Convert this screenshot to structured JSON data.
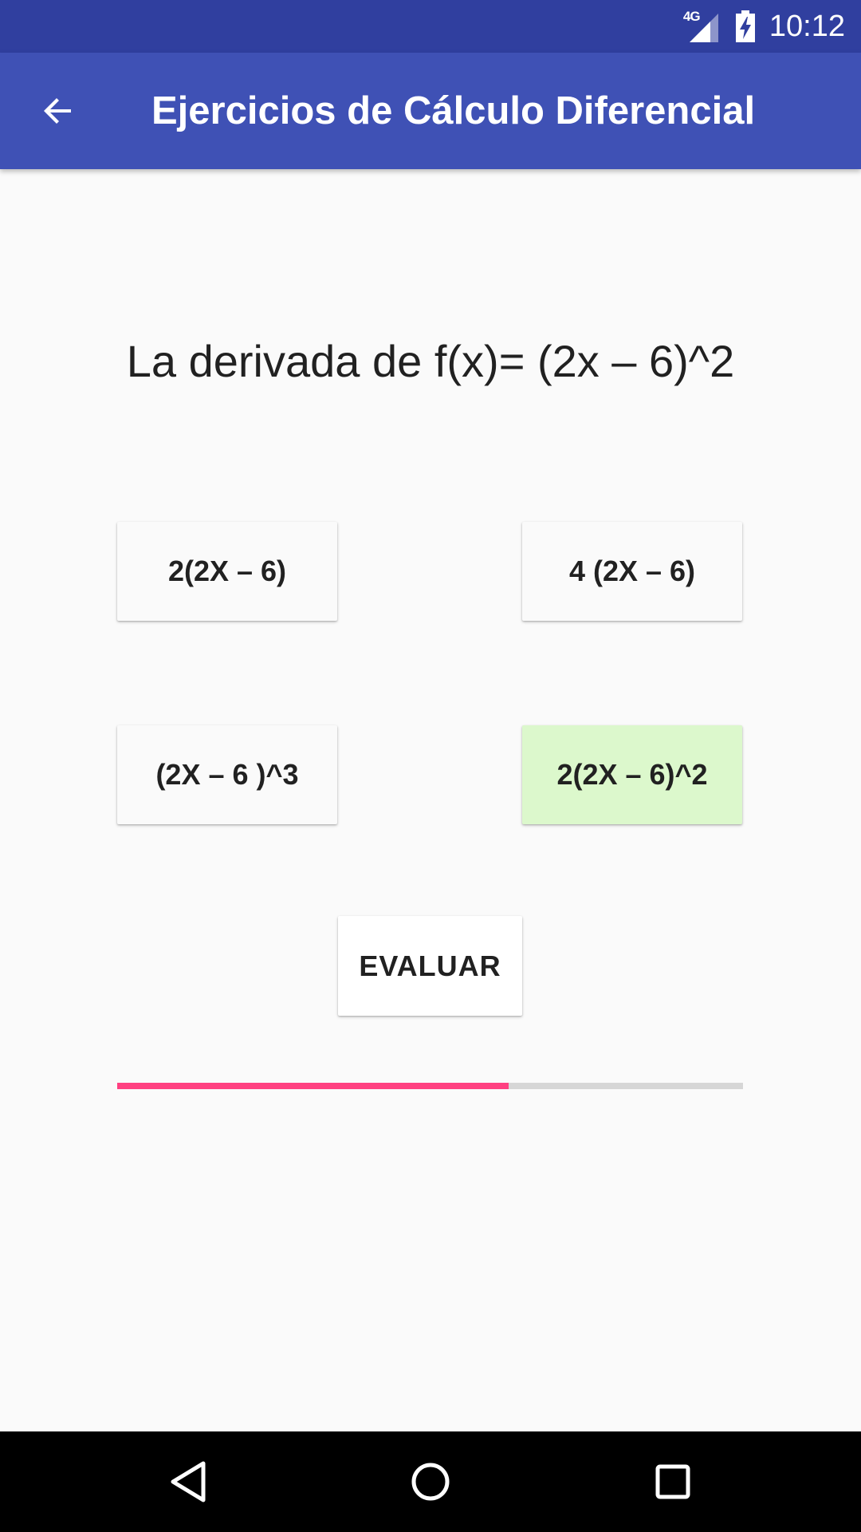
{
  "status_bar": {
    "network_label": "4G",
    "time": "10:12",
    "icons": [
      "signal-icon",
      "battery-charging-icon"
    ]
  },
  "app_bar": {
    "title": "Ejercicios de Cálculo Diferencial",
    "back_icon": "arrow-back-icon"
  },
  "question": {
    "text": "La derivada de f(x)= (2x – 6)^2"
  },
  "options": [
    {
      "label": "2(2X – 6)",
      "selected": false
    },
    {
      "label": "4 (2X – 6)",
      "selected": false
    },
    {
      "label": "(2X – 6 )^3",
      "selected": false
    },
    {
      "label": "2(2X – 6)^2",
      "selected": true
    }
  ],
  "evaluate_button": {
    "label": "EVALUAR"
  },
  "progress": {
    "value": 0.625,
    "fill_color": "#ff4081",
    "track_color": "#d6d6d6"
  },
  "colors": {
    "status_bar": "#303f9f",
    "app_bar": "#3f51b5",
    "selected_option": "#dcf8cc",
    "background": "#fafafa"
  },
  "nav_bar": {
    "icons": [
      "nav-back-icon",
      "nav-home-icon",
      "nav-recents-icon"
    ]
  }
}
